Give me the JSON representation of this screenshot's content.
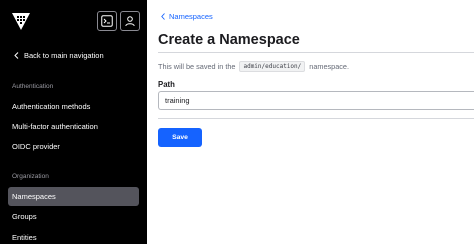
{
  "sidebar": {
    "back_label": "Back to main navigation",
    "sections": [
      {
        "title": "Authentication",
        "items": [
          "Authentication methods",
          "Multi-factor authentication",
          "OIDC provider"
        ]
      },
      {
        "title": "Organization",
        "items": [
          "Namespaces",
          "Groups",
          "Entities"
        ]
      }
    ],
    "active_item": "Namespaces"
  },
  "main": {
    "breadcrumb": "Namespaces",
    "title": "Create a Namespace",
    "description_prefix": "This will be saved in the",
    "namespace_path": "admin/education/",
    "description_suffix": "namespace.",
    "path_label": "Path",
    "path_value": "training",
    "save_label": "Save"
  },
  "colors": {
    "sidebar_bg": "#000000",
    "active_bg": "#54545c",
    "accent": "#1563ff"
  },
  "icons": [
    "vault-logo-icon",
    "terminal-icon",
    "user-icon",
    "chevron-left-icon"
  ]
}
